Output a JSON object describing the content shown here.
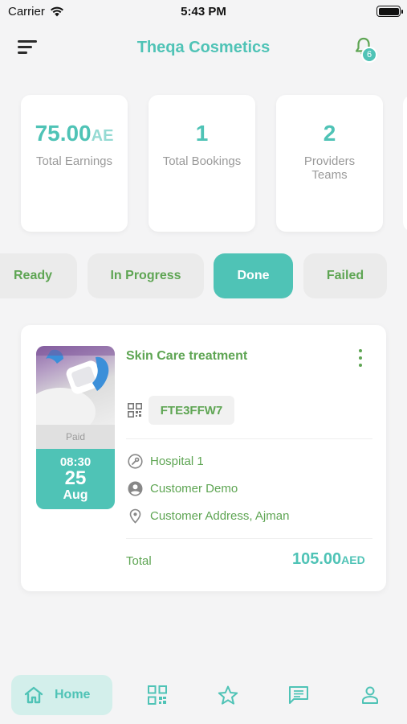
{
  "status_bar": {
    "carrier": "Carrier",
    "time": "5:43 PM"
  },
  "header": {
    "title": "Theqa Cosmetics",
    "notification_count": "6"
  },
  "stats": [
    {
      "value": "75.00",
      "unit": "AE",
      "label": "Total Earnings"
    },
    {
      "value": "1",
      "label": "Total Bookings"
    },
    {
      "value": "2",
      "label": "Providers Teams"
    }
  ],
  "tabs": [
    {
      "label": "Ready"
    },
    {
      "label": "In Progress"
    },
    {
      "label": "Done",
      "active": true
    },
    {
      "label": "Failed"
    }
  ],
  "booking": {
    "payment_status": "Paid",
    "time": "08:30",
    "day": "25",
    "month": "Aug",
    "service": "Skin Care treatment",
    "code": "FTE3FFW7",
    "location": "Hospital 1",
    "customer": "Customer Demo",
    "address": "Customer Address, Ajman",
    "total_label": "Total",
    "total_value": "105.00",
    "total_currency": "AED"
  },
  "bottom_nav": {
    "home_label": "Home",
    "items": [
      "home",
      "qr-code",
      "favorites",
      "messages",
      "profile"
    ]
  },
  "colors": {
    "accent": "#4fc3b6",
    "green": "#5ea553",
    "background": "#f4f4f5"
  }
}
